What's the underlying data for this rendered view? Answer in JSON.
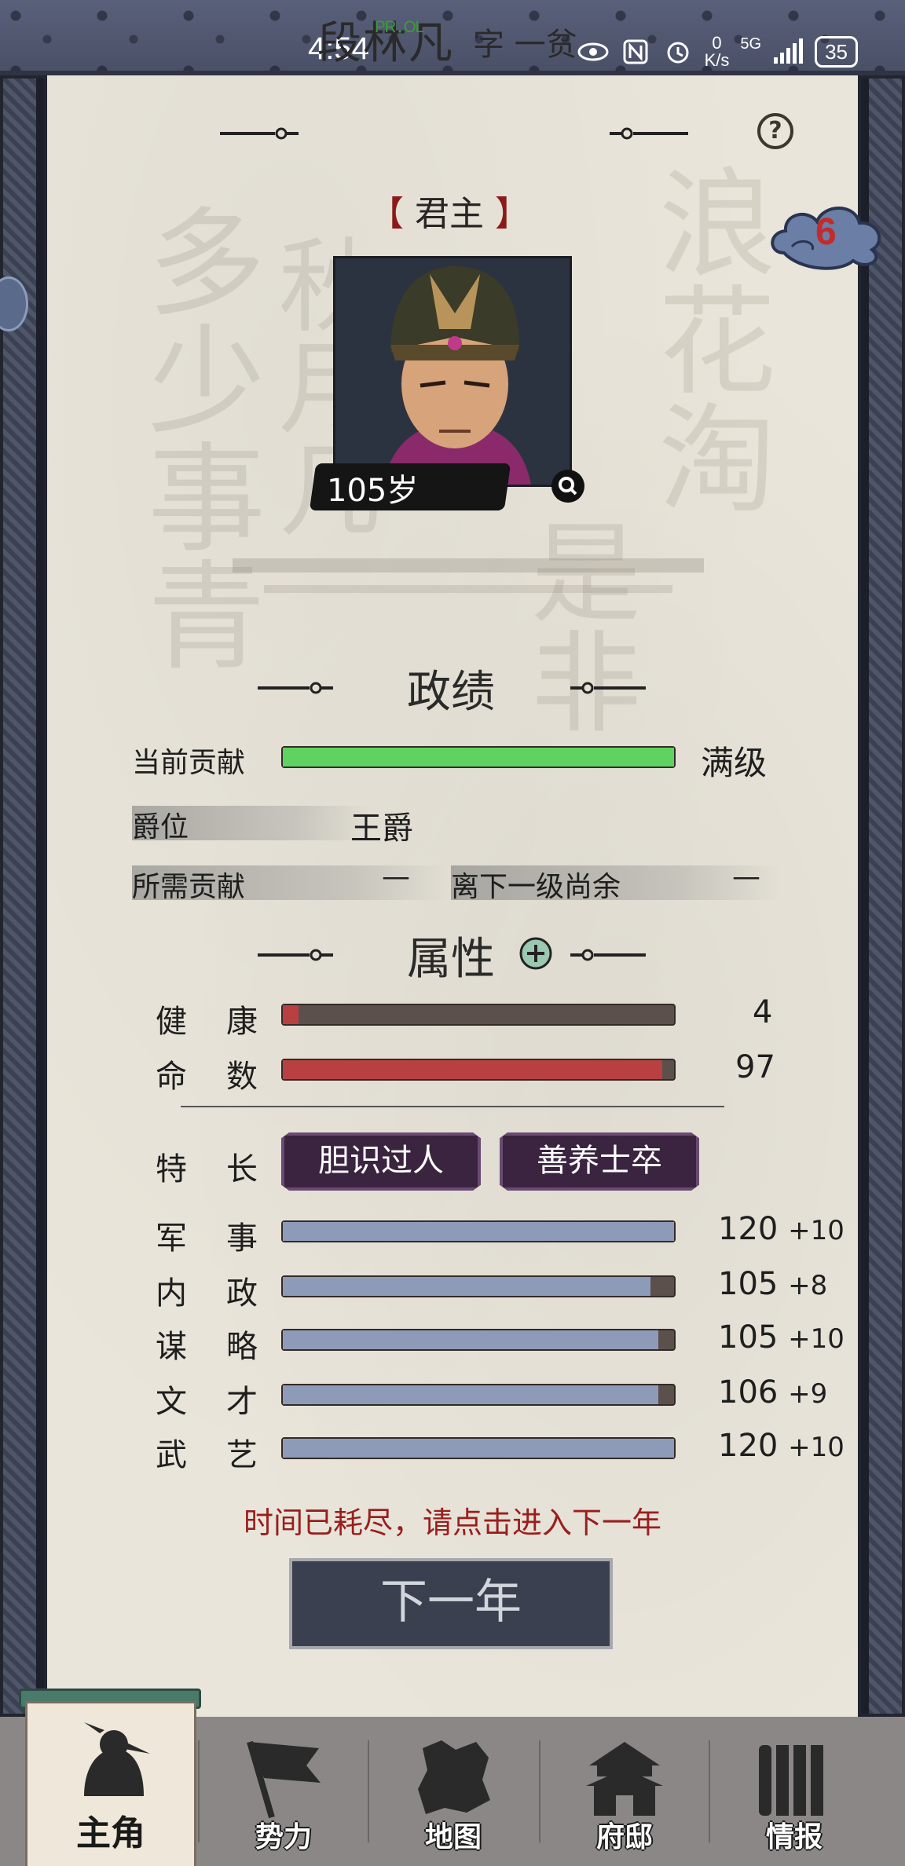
{
  "status_bar": {
    "time": "4:54",
    "net_speed_value": "0",
    "net_speed_unit": "K/s",
    "network": "5G",
    "battery": "35"
  },
  "header": {
    "name": "段林凡",
    "name_overlay": "ᴾᴿ·ᴼᴸ",
    "courtesy": "字 一贫",
    "help": "?"
  },
  "role": {
    "left_bracket": "【",
    "title": "君主",
    "right_bracket": "】"
  },
  "badge": {
    "count": "6"
  },
  "portrait": {
    "age": "105岁"
  },
  "achievement": {
    "title": "政绩",
    "contribution_label": "当前贡献",
    "contribution_fill": 1.0,
    "contribution_status": "满级",
    "rank_label": "爵位",
    "rank_value": "王爵",
    "required_label": "所需贡献",
    "required_value": "—",
    "remaining_label": "离下一级尚余",
    "remaining_value": "—"
  },
  "attributes": {
    "title": "属性",
    "health": {
      "label_a": "健",
      "label_b": "康",
      "value": "4",
      "fill": 0.04
    },
    "fate": {
      "label_a": "命",
      "label_b": "数",
      "value": "97",
      "fill": 0.97
    },
    "traits_label_a": "特",
    "traits_label_b": "长",
    "traits": [
      "胆识过人",
      "善养士卒"
    ],
    "stats": [
      {
        "label_a": "军",
        "label_b": "事",
        "value": "120",
        "bonus": "+10",
        "fill": 1.0
      },
      {
        "label_a": "内",
        "label_b": "政",
        "value": "105",
        "bonus": "+8",
        "fill": 0.94
      },
      {
        "label_a": "谋",
        "label_b": "略",
        "value": "105",
        "bonus": "+10",
        "fill": 0.96
      },
      {
        "label_a": "文",
        "label_b": "才",
        "value": "106",
        "bonus": "+9",
        "fill": 0.96
      },
      {
        "label_a": "武",
        "label_b": "艺",
        "value": "120",
        "bonus": "+10",
        "fill": 1.0
      }
    ]
  },
  "warning": "时间已耗尽，请点击进入下一年",
  "next_year_button": "下一年",
  "colors": {
    "contribution_bar": "#5fd35f",
    "health_bar": "#b84040",
    "stat_bar": "#8e9bb8",
    "warning_text": "#9a1e1e"
  },
  "nav": {
    "tabs": [
      {
        "label": "主角",
        "icon": "warrior-icon",
        "active": true
      },
      {
        "label": "势力",
        "icon": "flag-icon",
        "active": false
      },
      {
        "label": "地图",
        "icon": "map-icon",
        "active": false
      },
      {
        "label": "府邸",
        "icon": "mansion-icon",
        "active": false
      },
      {
        "label": "情报",
        "icon": "scroll-icon",
        "active": false
      }
    ]
  }
}
